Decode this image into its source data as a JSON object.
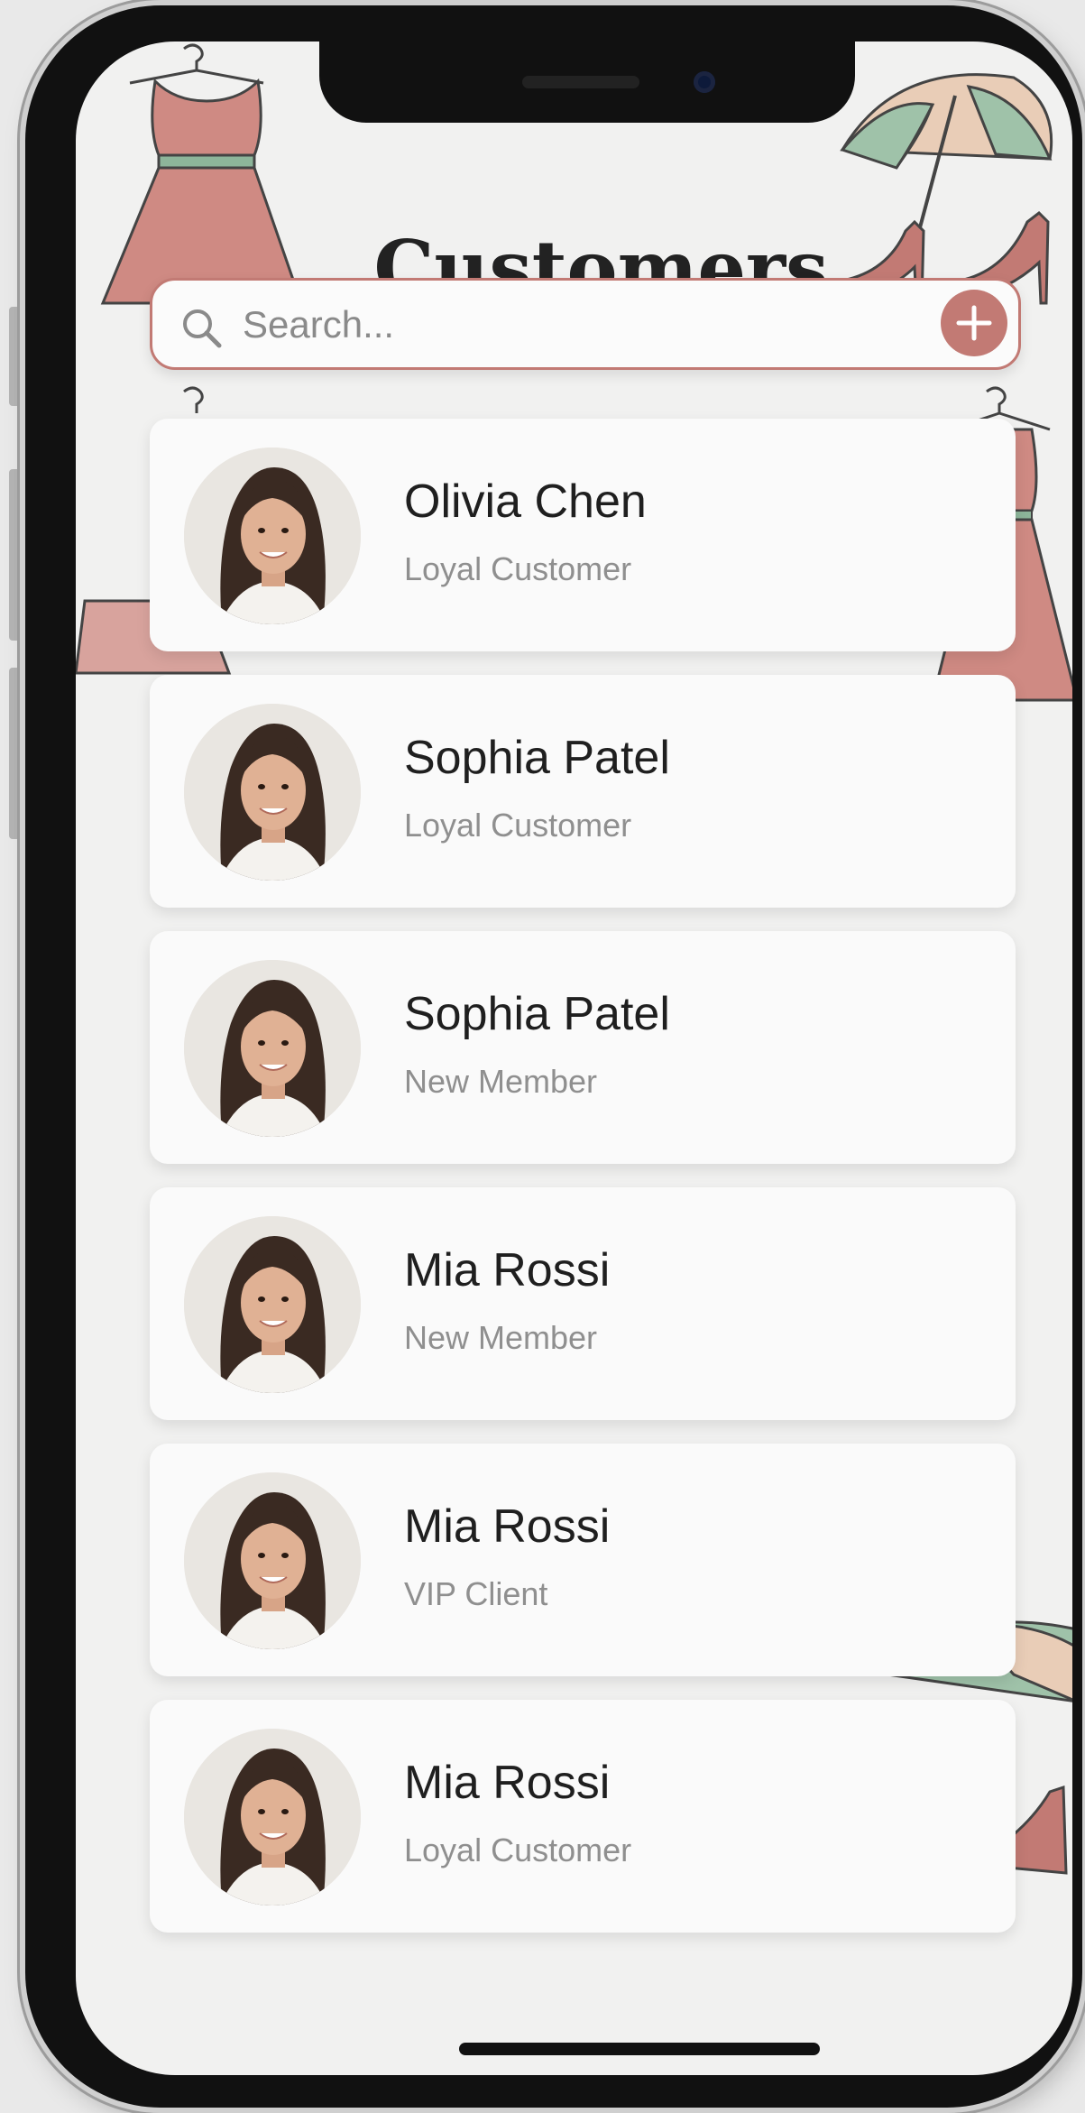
{
  "header": {
    "title": "Customers"
  },
  "search": {
    "placeholder": "Search...",
    "value": ""
  },
  "add_button": {
    "icon": "plus-icon"
  },
  "customers": [
    {
      "name": "Olivia Chen",
      "status": "Loyal Customer"
    },
    {
      "name": "Sophia Patel",
      "status": "Loyal Customer"
    },
    {
      "name": "Sophia Patel",
      "status": "New Member"
    },
    {
      "name": "Mia Rossi",
      "status": "New Member"
    },
    {
      "name": "Mia Rossi",
      "status": "VIP Client"
    },
    {
      "name": "Mia Rossi",
      "status": "Loyal Customer"
    }
  ],
  "colors": {
    "accent": "#c27a74",
    "background": "#f1f1f0",
    "card": "#fafafa",
    "name_text": "#1f1f1f",
    "status_text": "#8f8f8f",
    "sage": "#8db59a"
  }
}
